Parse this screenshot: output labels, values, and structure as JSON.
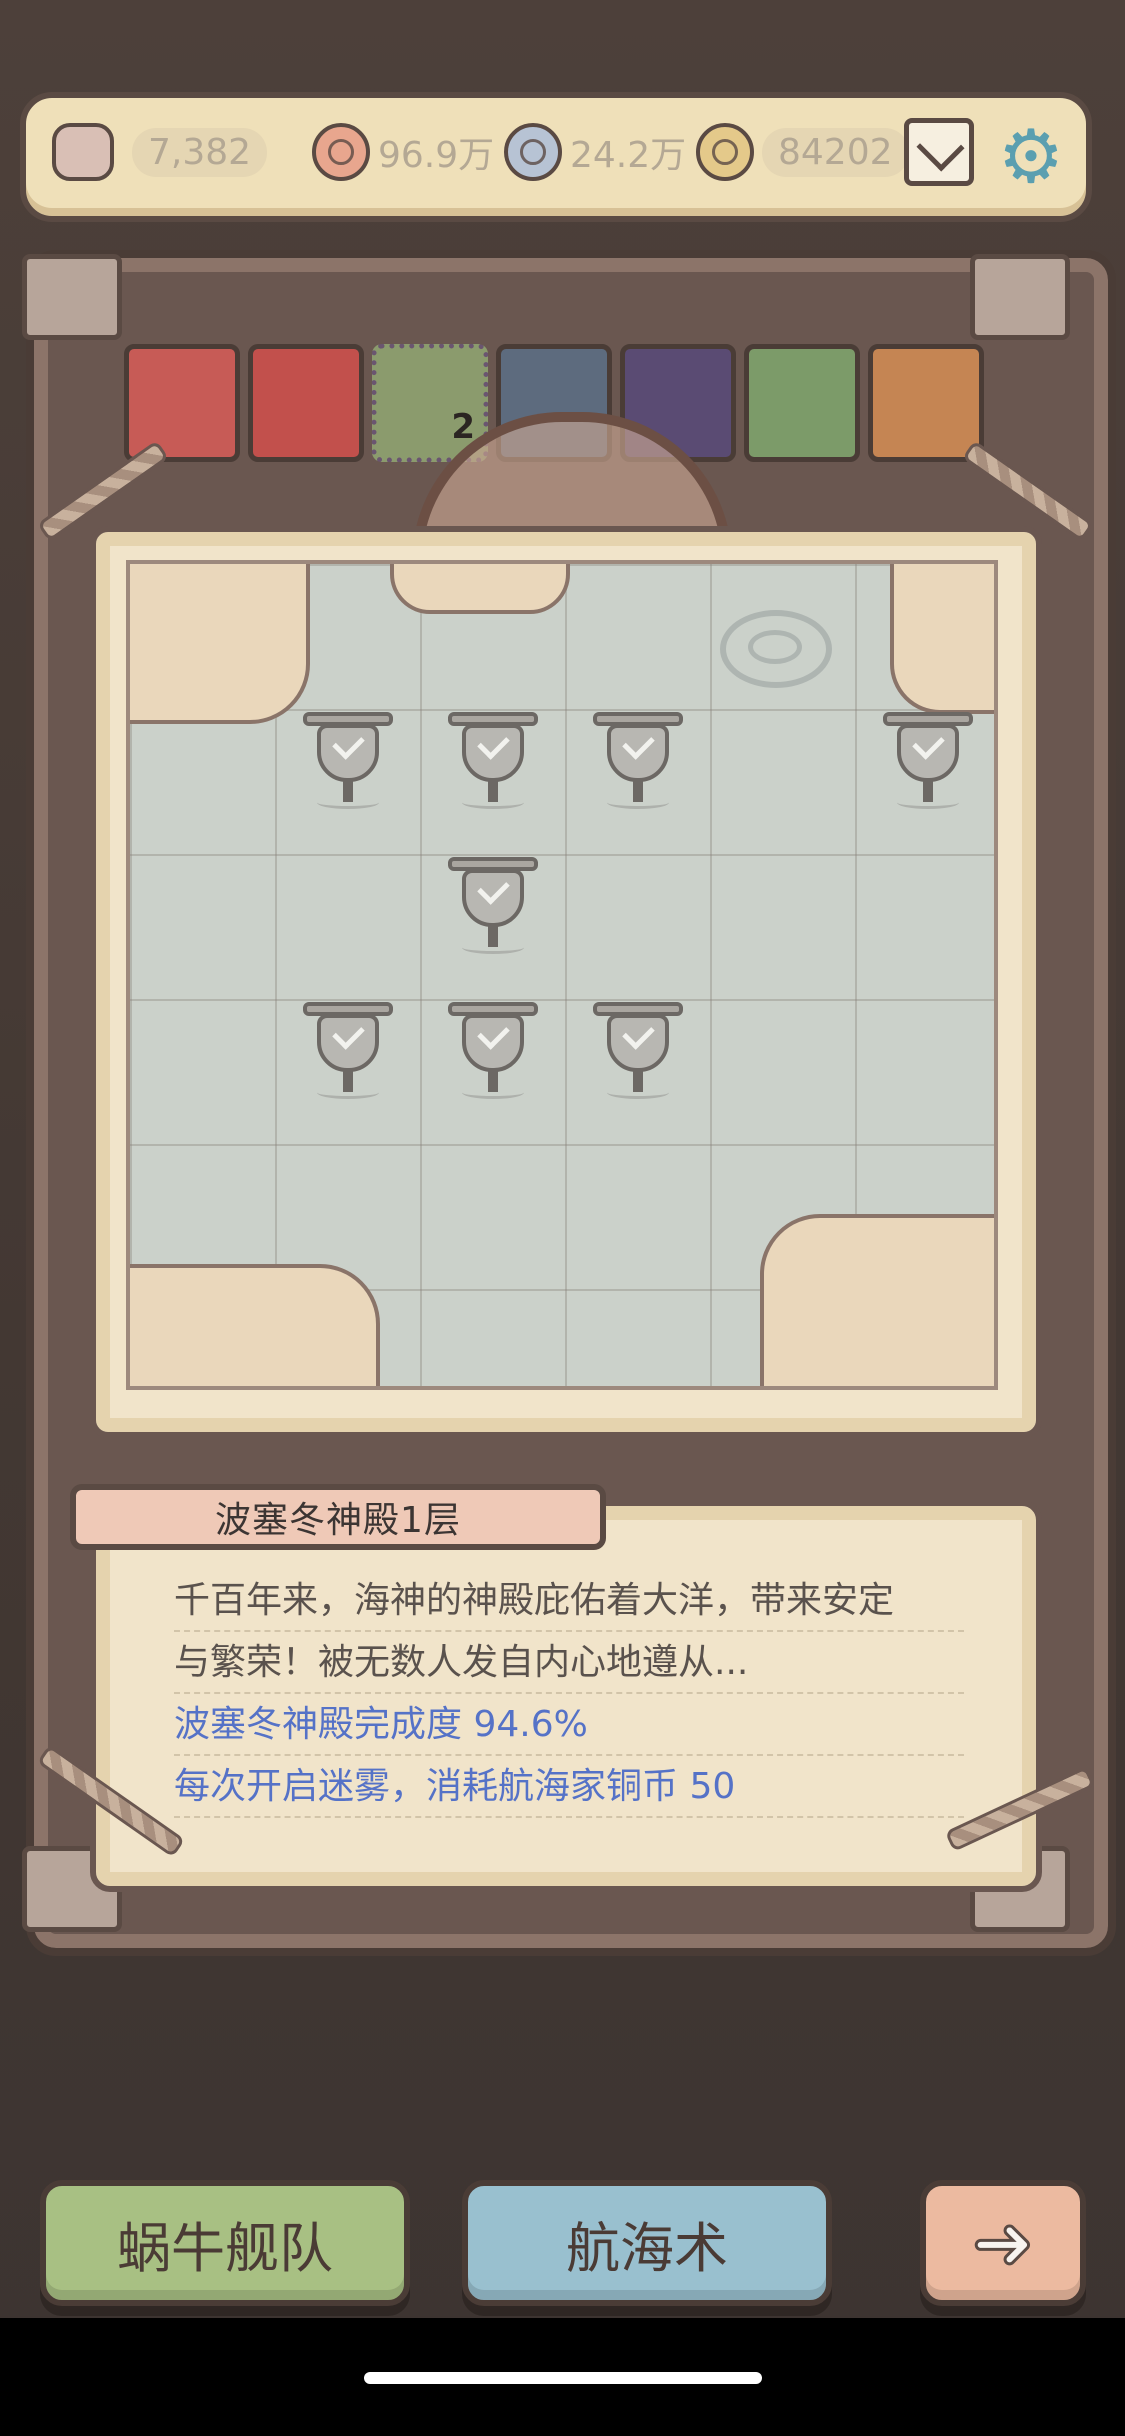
{
  "currencies": {
    "snail_count": "7,382",
    "copper": "96.9万",
    "silver": "24.2万",
    "gold": "84202"
  },
  "map": {
    "checkpoints": [
      {
        "row": 1,
        "col": 2
      },
      {
        "row": 1,
        "col": 3
      },
      {
        "row": 1,
        "col": 4
      },
      {
        "row": 1,
        "col": 6
      },
      {
        "row": 2,
        "col": 3
      },
      {
        "row": 3,
        "col": 2
      },
      {
        "row": 3,
        "col": 3
      },
      {
        "row": 3,
        "col": 4
      }
    ]
  },
  "slot_badge": "2",
  "level": {
    "title": "波塞冬神殿1层",
    "desc_line1": "千百年来，海神的神殿庇佑着大洋，带来安定",
    "desc_line2": "与繁荣！被无数人发自内心地遵从...",
    "completion": "波塞冬神殿完成度 94.6%",
    "cost": "每次开启迷雾，消耗航海家铜币 50"
  },
  "buttons": {
    "fleet": "蜗牛舰队",
    "navigation": "航海术"
  },
  "colors": {
    "accent_blue": "#5572c7",
    "fleet_green": "#a8c083",
    "nav_blue": "#99c0cf",
    "next_peach": "#ecbaa0"
  }
}
